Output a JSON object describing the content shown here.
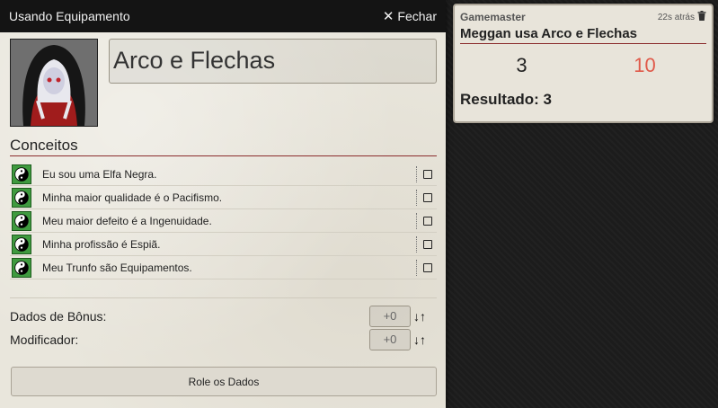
{
  "window": {
    "title": "Usando Equipamento",
    "close_label": "Fechar"
  },
  "item": {
    "name": "Arco e Flechas"
  },
  "concepts": {
    "title": "Conceitos",
    "items": [
      {
        "label": "Eu sou uma Elfa Negra."
      },
      {
        "label": "Minha maior qualidade é o Pacifismo."
      },
      {
        "label": "Meu maior defeito é a Ingenuidade."
      },
      {
        "label": "Minha profissão é Espiã."
      },
      {
        "label": "Meu Trunfo são Equipamentos."
      }
    ]
  },
  "bonus": {
    "label": "Dados de Bônus:",
    "value": "+0",
    "down": "↓",
    "up": "↑"
  },
  "modifier": {
    "label": "Modificador:",
    "value": "+0",
    "down": "↓",
    "up": "↑"
  },
  "roll_button": "Role os Dados",
  "chat": {
    "speaker": "Gamemaster",
    "time": "22s atrás",
    "message": "Meggan usa Arco e Flechas",
    "dice": [
      "3",
      "10"
    ],
    "result": "Resultado: 3"
  },
  "colors": {
    "accent_rule": "#8b2d2d",
    "concept_icon_bg": "#3f9a3f",
    "high_die": "#e05a4a"
  },
  "icons": {
    "close": "close-icon",
    "concept": "yin-yang-icon",
    "delete": "trash-icon"
  }
}
